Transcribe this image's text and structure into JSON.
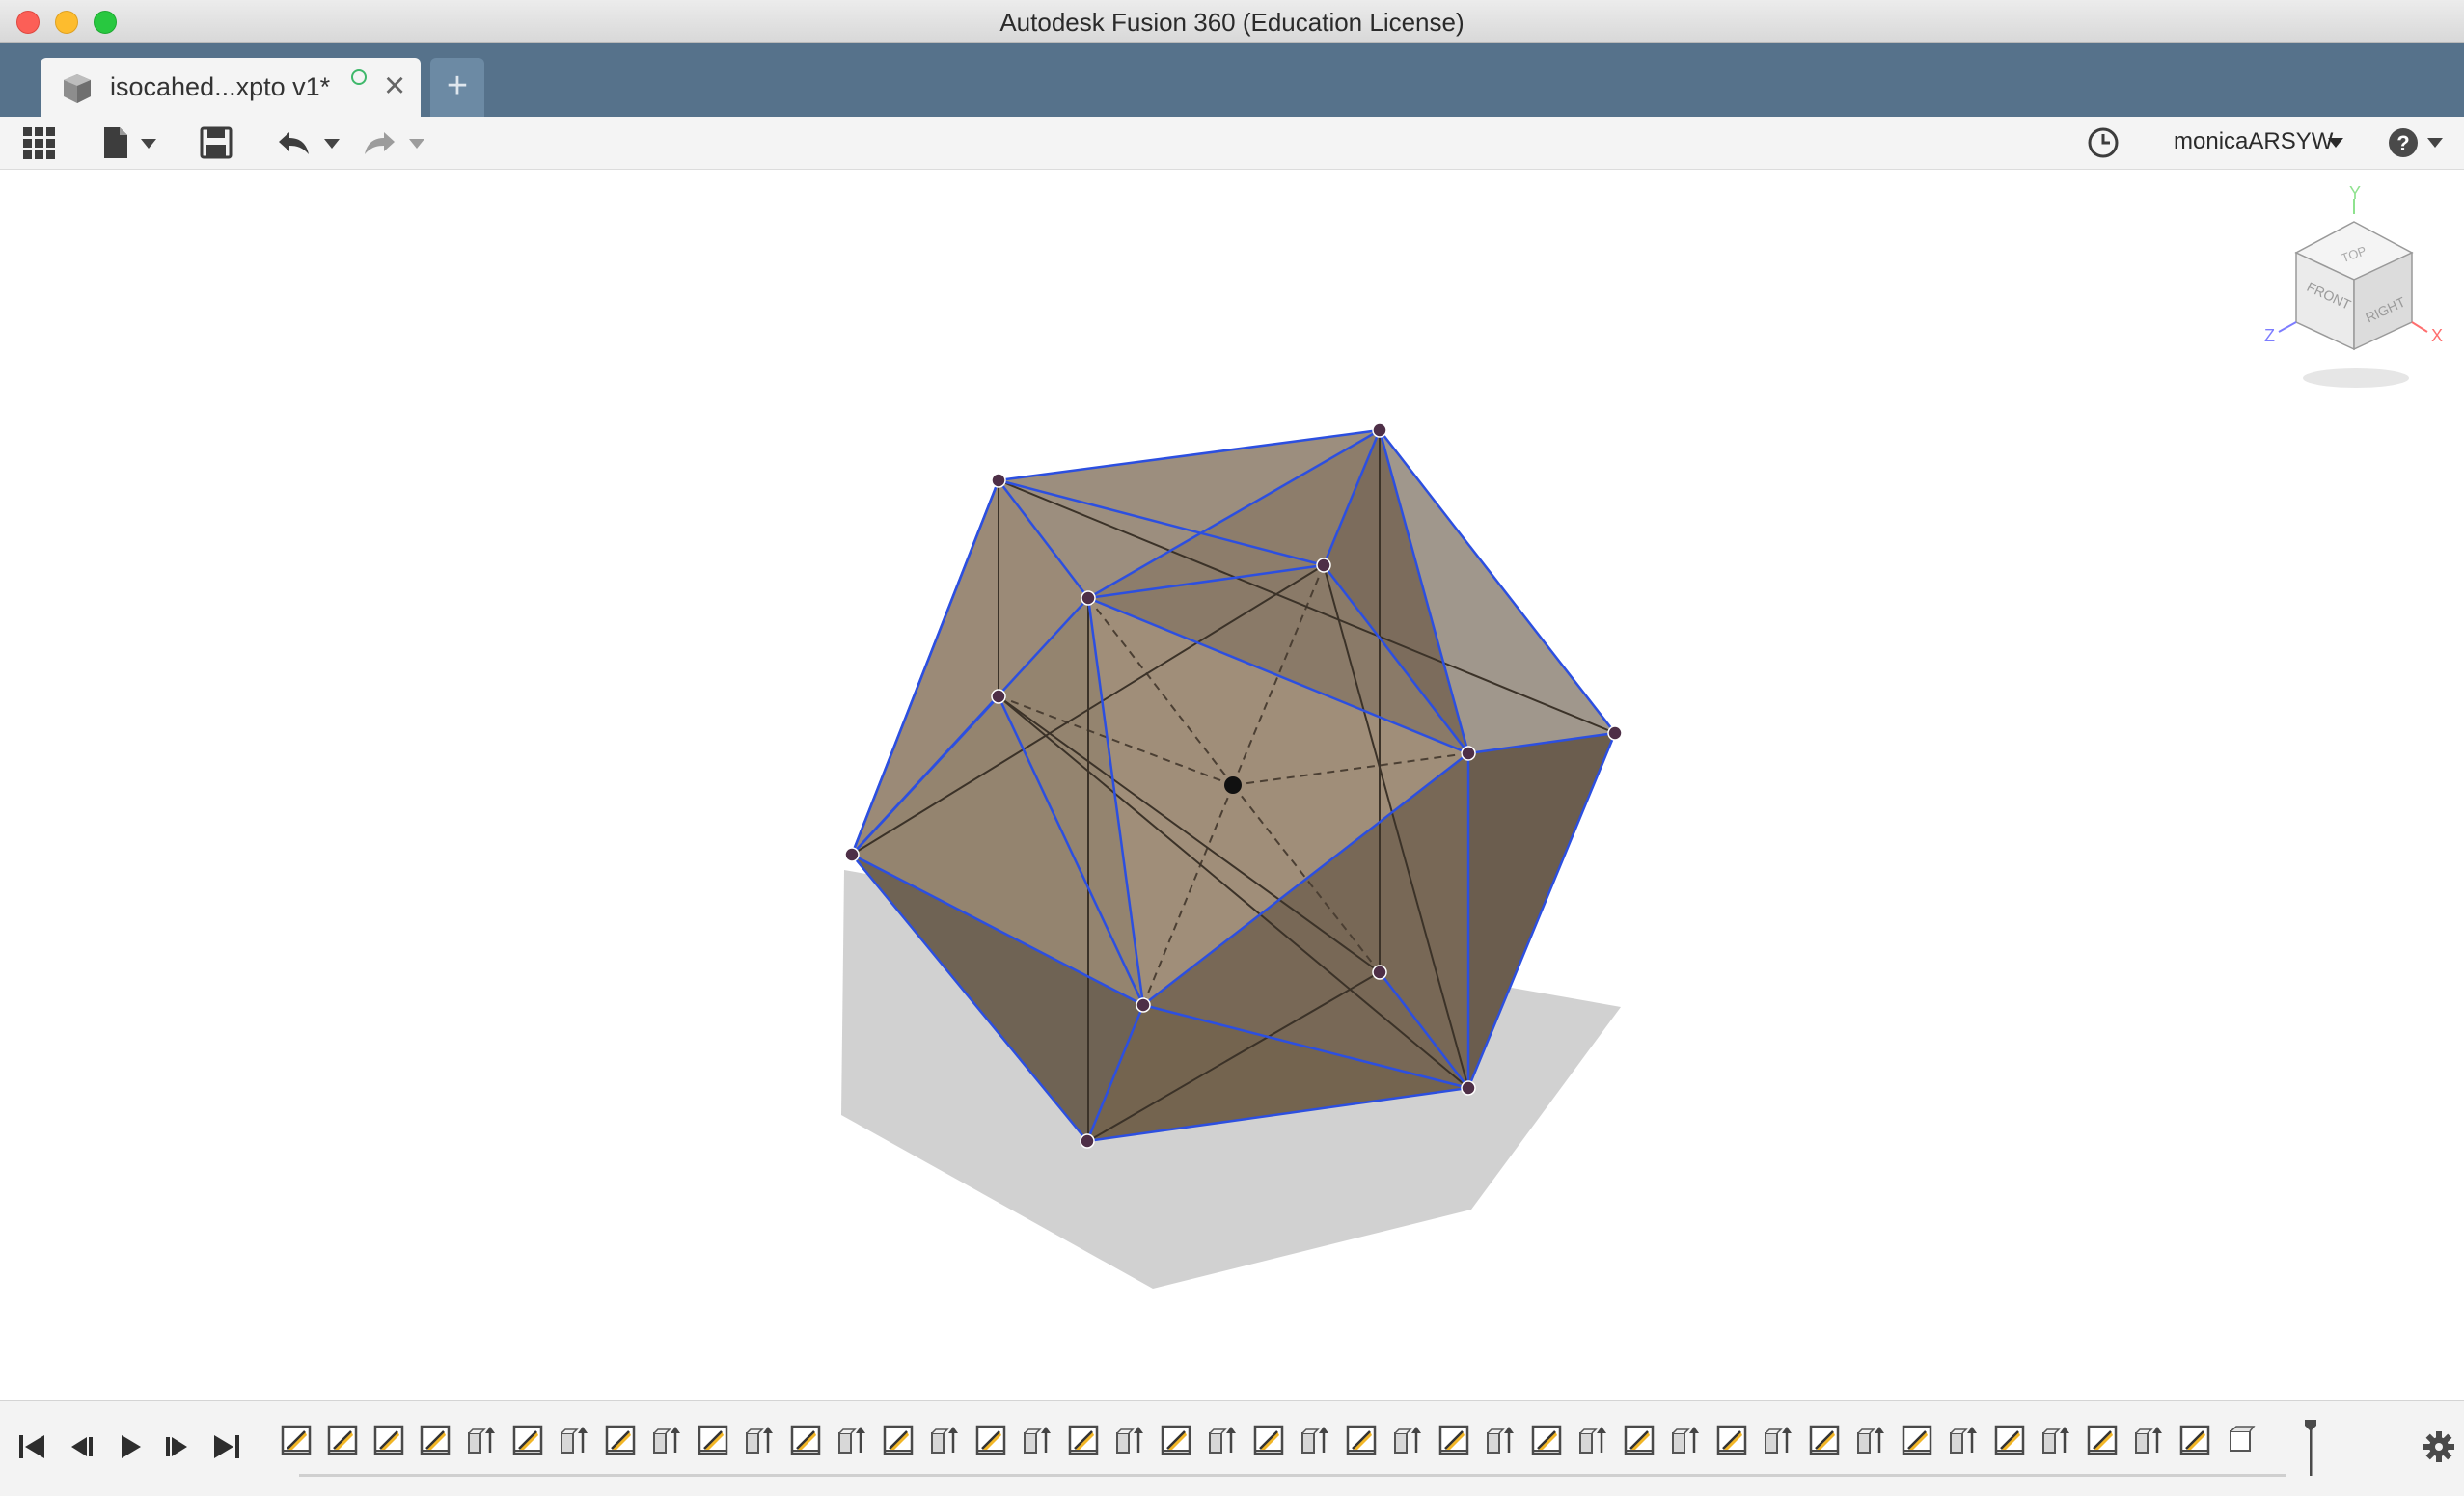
{
  "window": {
    "title": "Autodesk Fusion 360 (Education License)"
  },
  "tabs": {
    "active": {
      "title": "isocahed...xpto v1*",
      "icon": "box-document-icon",
      "status_icon": "sync-circle-icon",
      "close_icon": "close-icon"
    },
    "new_tab_label": "+"
  },
  "toolbar": {
    "left_icons": [
      "app-grid-icon",
      "file-icon",
      "save-icon",
      "undo-icon",
      "redo-icon"
    ],
    "right": {
      "history_icon": "clock-icon",
      "user": "monicaARSYW",
      "help_icon": "help-icon"
    }
  },
  "viewcube": {
    "faces": [
      "TOP",
      "FRONT",
      "RIGHT"
    ],
    "axes": [
      "Y",
      "Z",
      "X"
    ],
    "axis_colors": {
      "x": "#ff6f6f",
      "y": "#8ee28e",
      "z": "#7d7dff"
    }
  },
  "model": {
    "name": "icosahedron",
    "face_color": "#8f7f6c",
    "edge_color": "#2c4fe0"
  },
  "timeline": {
    "controls": [
      "skip-to-start-icon",
      "step-back-icon",
      "play-icon",
      "step-forward-icon",
      "skip-to-end-icon"
    ],
    "feature_count": 43,
    "settings_icon": "gear-icon"
  }
}
